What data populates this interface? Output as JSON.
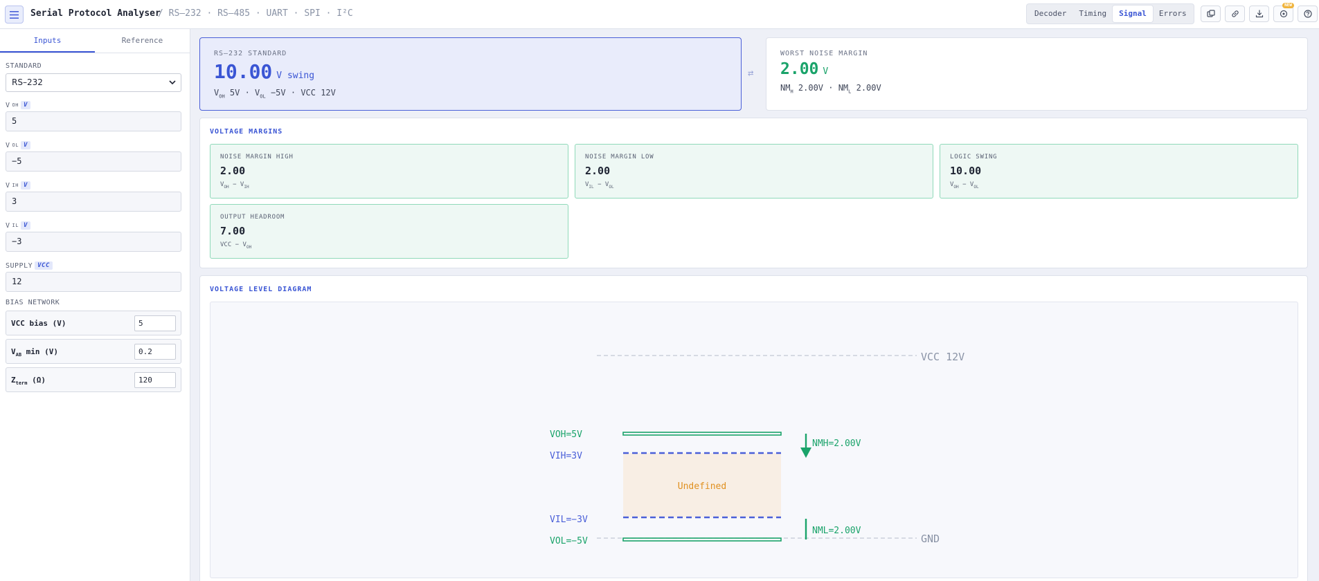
{
  "header": {
    "app_title": "Serial Protocol Analyser",
    "breadcrumb": "/ RS–232 · RS–485 · UART · SPI · I²C",
    "tabs": [
      "Decoder",
      "Timing",
      "Signal",
      "Errors"
    ],
    "active_tab": "Signal",
    "icons": [
      "copy-icon",
      "link-icon",
      "download-icon",
      "badge-icon",
      "help-icon"
    ],
    "badge_text": "NEW"
  },
  "sidebar": {
    "tabs": [
      "Inputs",
      "Reference"
    ],
    "active_tab": "Inputs",
    "standard_label": "STANDARD",
    "standard_value": "RS–232",
    "fields": {
      "voh": {
        "label": "V",
        "sub": "OH",
        "unit": "V",
        "value": "5"
      },
      "vol": {
        "label": "V",
        "sub": "OL",
        "unit": "V",
        "value": "−5"
      },
      "vih": {
        "label": "V",
        "sub": "IH",
        "unit": "V",
        "value": "3"
      },
      "vil": {
        "label": "V",
        "sub": "IL",
        "unit": "V",
        "value": "−3"
      },
      "supply": {
        "label": "SUPPLY",
        "unit": "VCC",
        "value": "12"
      }
    },
    "bias_title": "BIAS NETWORK",
    "bias": {
      "vcc": {
        "label": "VCC bias (V)",
        "value": "5"
      },
      "vab": {
        "label_main": "V",
        "label_sub": "AB",
        "label_rest": " min (V)",
        "value": "0.2"
      },
      "zterm": {
        "label_main": "Z",
        "label_sub": "term",
        "label_rest": " (Ω)",
        "value": "120"
      }
    }
  },
  "summary": {
    "standard_card": {
      "label": "RS–232 STANDARD",
      "value": "10.00",
      "unit": "V swing",
      "detail": {
        "voh": "5V",
        "vol": "−5V",
        "vcc": "VCC 12V"
      }
    },
    "swap_icon": "⇄",
    "noise_card": {
      "label": "WORST NOISE MARGIN",
      "value": "2.00",
      "unit": "V",
      "nmh": "2.00V",
      "nml": "2.00V"
    }
  },
  "margins": {
    "title": "VOLTAGE MARGINS",
    "cards": [
      {
        "label": "NOISE MARGIN HIGH",
        "value": "2.00",
        "a": "OH",
        "b": "IH"
      },
      {
        "label": "NOISE MARGIN LOW",
        "value": "2.00",
        "a": "IL",
        "b": "OL"
      },
      {
        "label": "LOGIC SWING",
        "value": "10.00",
        "a": "OH",
        "b": "OL"
      },
      {
        "label": "OUTPUT HEADROOM",
        "value": "7.00",
        "pre": "VCC",
        "b": "OH"
      }
    ]
  },
  "diagram": {
    "title": "VOLTAGE LEVEL DIAGRAM",
    "vcc_label": "VCC 12V",
    "gnd_label": "GND",
    "voh_label": "VOH=5V",
    "vih_label": "VIH=3V",
    "vil_label": "VIL=−3V",
    "vol_label": "VOL=−5V",
    "undefined_label": "Undefined",
    "nmh_label": "NMH=2.00V",
    "nml_label": "NML=2.00V",
    "colors": {
      "green": "#1aa36a",
      "blue": "#4a5fd8",
      "amber": "#e0901f",
      "grey": "#8a93a6"
    }
  }
}
